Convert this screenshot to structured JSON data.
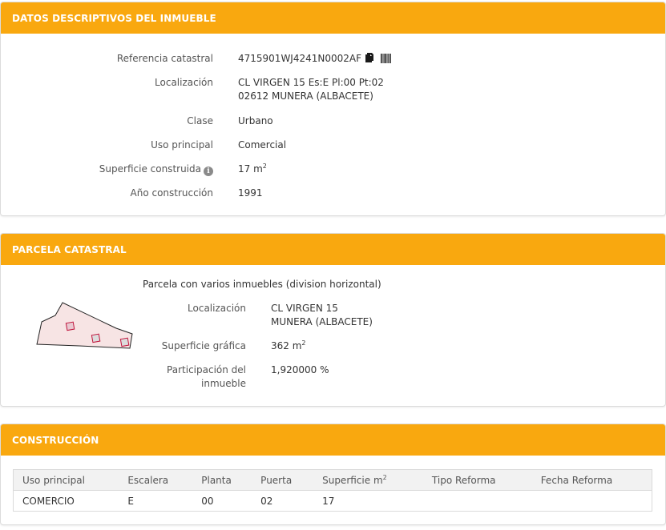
{
  "datos": {
    "title": "DATOS DESCRIPTIVOS DEL INMUEBLE",
    "referencia_label": "Referencia catastral",
    "referencia_value": "4715901WJ4241N0002AF",
    "localizacion_label": "Localización",
    "localizacion_line1": "CL VIRGEN 15 Es:E Pl:00 Pt:02",
    "localizacion_line2": "02612 MUNERA (ALBACETE)",
    "clase_label": "Clase",
    "clase_value": "Urbano",
    "uso_label": "Uso principal",
    "uso_value": "Comercial",
    "superficie_label": "Superficie construida",
    "superficie_value": "17 m",
    "superficie_sup": "2",
    "anio_label": "Año construcción",
    "anio_value": "1991",
    "icons": [
      "copy-icon",
      "barcode-icon",
      "info-icon"
    ]
  },
  "parcela": {
    "title": "PARCELA CATASTRAL",
    "subtitle": "Parcela con varios inmuebles (division horizontal)",
    "localizacion_label": "Localización",
    "localizacion_line1": "CL VIRGEN 15",
    "localizacion_line2": "MUNERA (ALBACETE)",
    "superficie_label": "Superficie gráfica",
    "superficie_value": "362 m",
    "superficie_sup": "2",
    "participacion_label_line1": "Participación del",
    "participacion_label_line2": "inmueble",
    "participacion_value": "1,920000 %",
    "colors": {
      "parcel_fill": "#f7e4e4",
      "unit_stroke": "#c0143c"
    }
  },
  "construccion": {
    "title": "CONSTRUCCIÓN",
    "headers": [
      "Uso principal",
      "Escalera",
      "Planta",
      "Puerta",
      "Superficie m",
      "Tipo Reforma",
      "Fecha Reforma"
    ],
    "superficie_header_sup": "2",
    "rows": [
      [
        "COMERCIO",
        "E",
        "00",
        "02",
        "17",
        "",
        ""
      ]
    ]
  },
  "accent_color": "#f9a80f"
}
